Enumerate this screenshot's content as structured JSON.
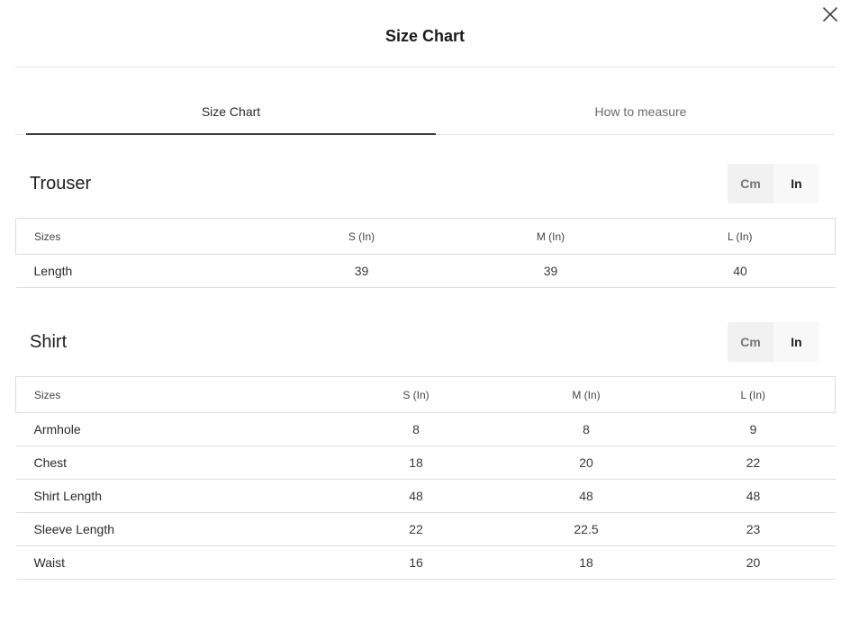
{
  "modal": {
    "title": "Size Chart",
    "close_icon": "close-icon"
  },
  "tabs": [
    {
      "label": "Size Chart",
      "active": true
    },
    {
      "label": "How to measure",
      "active": false
    }
  ],
  "units": {
    "cm_label": "Cm",
    "in_label": "In",
    "selected": "In"
  },
  "trouser": {
    "title": "Trouser",
    "headers": [
      "Sizes",
      "S (In)",
      "M (In)",
      "L (In)"
    ],
    "rows": [
      {
        "label": "Length",
        "values": [
          "39",
          "39",
          "40"
        ]
      }
    ]
  },
  "shirt": {
    "title": "Shirt",
    "headers": [
      "Sizes",
      "S (In)",
      "M (In)",
      "L (In)"
    ],
    "rows": [
      {
        "label": "Armhole",
        "values": [
          "8",
          "8",
          "9"
        ]
      },
      {
        "label": "Chest",
        "values": [
          "18",
          "20",
          "22"
        ]
      },
      {
        "label": "Shirt Length",
        "values": [
          "48",
          "48",
          "48"
        ]
      },
      {
        "label": "Sleeve Length",
        "values": [
          "22",
          "22.5",
          "23"
        ]
      },
      {
        "label": "Waist",
        "values": [
          "16",
          "18",
          "20"
        ]
      }
    ]
  }
}
